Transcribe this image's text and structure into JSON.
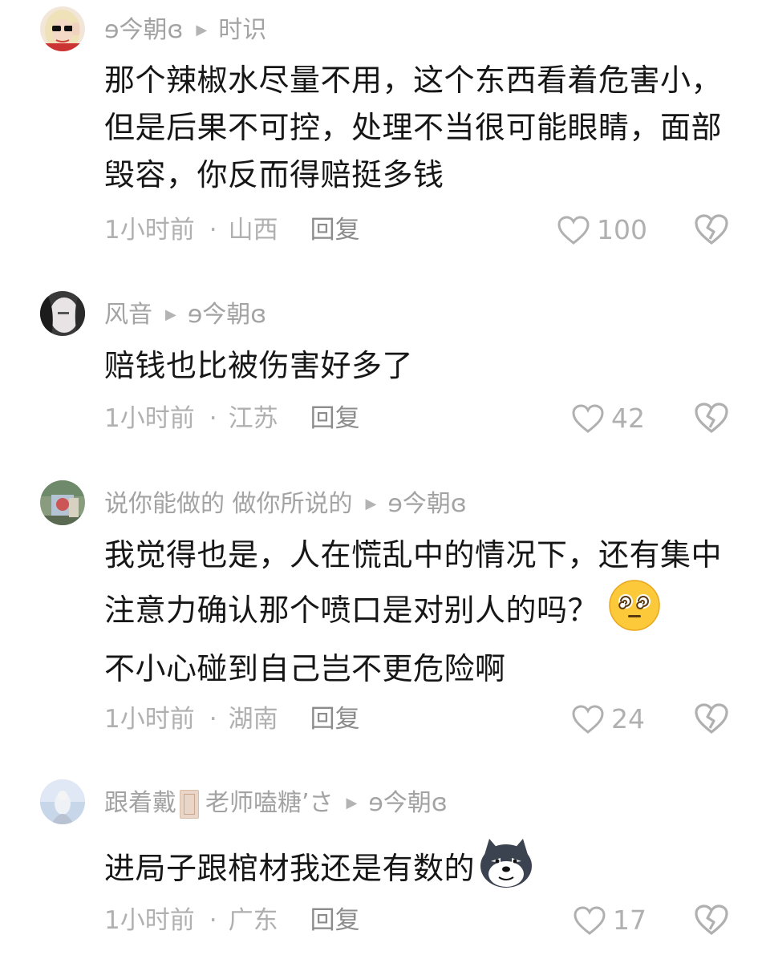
{
  "comments": [
    {
      "author": "ɘ今朝ɞ",
      "reply_to": "时识",
      "text": "那个辣椒水尽量不用，这个东西看着危害小，但是后果不可控，处理不当很可能眼睛，面部毁容，你反而得赔挺多钱",
      "time": "1小时前",
      "location": "山西",
      "reply_label": "回复",
      "likes": "100"
    },
    {
      "author": "风音",
      "reply_to": "ɘ今朝ɞ",
      "text": "赔钱也比被伤害好多了",
      "time": "1小时前",
      "location": "江苏",
      "reply_label": "回复",
      "likes": "42"
    },
    {
      "author": "说你能做的 做你所说的",
      "reply_to": "ɘ今朝ɞ",
      "text": "我觉得也是，人在慌乱中的情况下，还有集中注意力确认那个喷口是对别人的吗？",
      "text_after_emoji": "不小心碰到自己岂不更危险啊",
      "emoji": "dizzy-face-emoji",
      "time": "1小时前",
      "location": "湖南",
      "reply_label": "回复",
      "likes": "24"
    },
    {
      "author_prefix": "跟着戴",
      "author_suffix": "老师嗑糖’さ",
      "reply_to": "ɘ今朝ɞ",
      "text": "进局子跟棺材我还是有数的",
      "emoji": "doge-sticker",
      "time": "1小时前",
      "location": "广东",
      "reply_label": "回复",
      "likes": "17"
    }
  ],
  "colors": {
    "meta": "#b0b0b0",
    "reply": "#8c8c8c",
    "text": "#161616"
  }
}
